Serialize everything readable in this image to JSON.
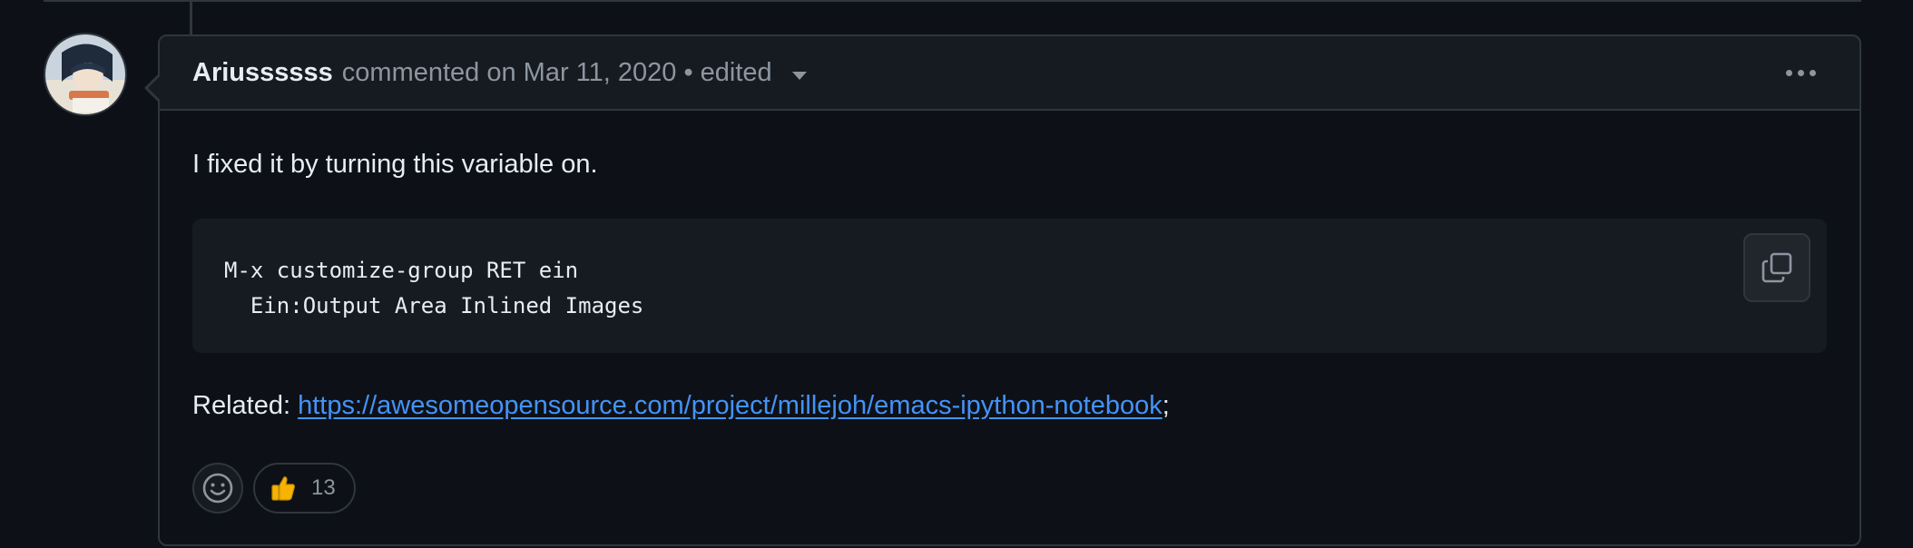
{
  "comment": {
    "author": "Ariussssss",
    "meta_text": "commented on Mar 11, 2020 • edited",
    "body_text": "I fixed it by turning this variable on.",
    "code_lines": [
      "M-x customize-group RET ein",
      "  Ein:Output Area Inlined Images"
    ],
    "related_label": "Related: ",
    "related_link": "https://awesomeopensource.com/project/millejoh/emacs-ipython-notebook",
    "related_suffix": ";"
  },
  "reactions": {
    "thumbs_up_count": "13"
  },
  "icons": {
    "more": "kebab-horizontal-icon",
    "copy": "copy-icon",
    "smiley": "smiley-icon",
    "thumbs_up": "thumbs-up-emoji",
    "caret": "triangle-down-icon"
  },
  "colors": {
    "background": "#0d1117",
    "header_bg": "#161b22",
    "border": "#30363d",
    "link": "#4493f8",
    "muted": "#8d96a0"
  }
}
